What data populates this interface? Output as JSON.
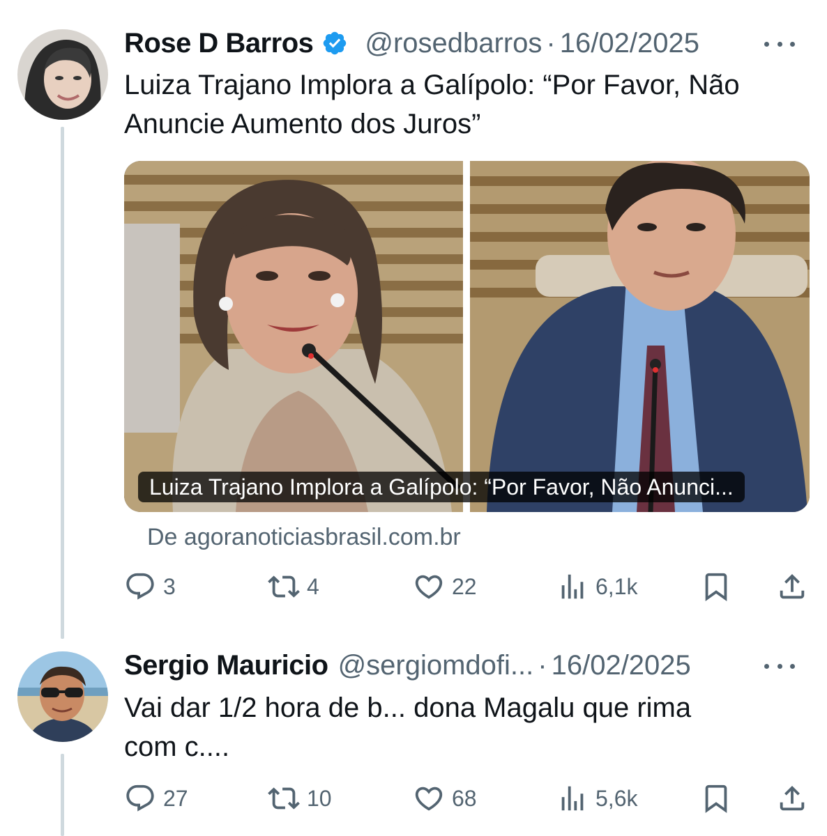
{
  "colors": {
    "text": "#0f1419",
    "secondary": "#536471",
    "verified": "#1d9bf0",
    "thread_line": "#cfd9de"
  },
  "tweets": [
    {
      "name": "Rose D Barros",
      "verified": true,
      "handle": "@rosedbarros",
      "separator": "·",
      "date": "16/02/2025",
      "text": "Luiza Trajano Implora a Galípolo: “Por Favor, Não\nAnuncie Aumento dos Juros”",
      "card": {
        "caption": "Luiza Trajano Implora a Galípolo: “Por Favor, Não Anunci...",
        "source": "De agoranoticiasbrasil.com.br"
      },
      "actions": {
        "replies": "3",
        "retweets": "4",
        "likes": "22",
        "views": "6,1k"
      }
    },
    {
      "name": "Sergio Mauricio",
      "verified": false,
      "handle": "@sergiomdofi...",
      "separator": "·",
      "date": "16/02/2025",
      "text": "Vai dar 1/2 hora de b... dona Magalu que rima\ncom c....",
      "actions": {
        "replies": "27",
        "retweets": "10",
        "likes": "68",
        "views": "5,6k"
      }
    }
  ]
}
